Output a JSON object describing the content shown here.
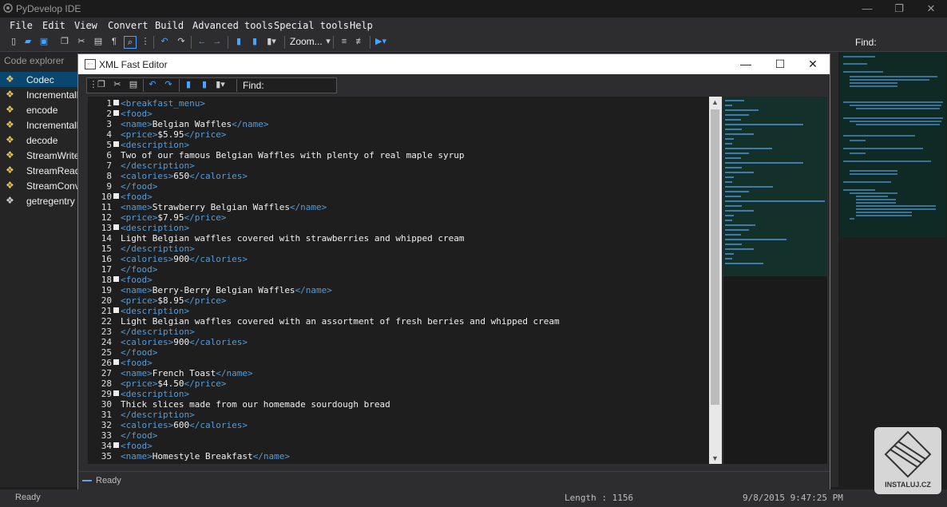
{
  "app": {
    "title": "PyDevelop IDE"
  },
  "menu": [
    "File",
    "Edit",
    "View",
    "Convert",
    "Build",
    "Advanced tools",
    "Special tools",
    "Help"
  ],
  "toolbar": {
    "zoom_label": "Zoom...",
    "find_label": "Find:"
  },
  "explorer": {
    "header": "Code explorer",
    "items": [
      "Codec",
      "Incrementall",
      "encode",
      "Incrementall",
      "decode",
      "StreamWrite",
      "StreamRead",
      "StreamConv",
      "getregentry"
    ]
  },
  "dialog": {
    "title": "XML Fast Editor",
    "find_label": "Find:",
    "status": "Ready"
  },
  "editor": {
    "lines": [
      {
        "n": "1",
        "fold": true,
        "parts": [
          [
            "tag",
            "<breakfast_menu>"
          ]
        ]
      },
      {
        "n": "2",
        "fold": true,
        "parts": [
          [
            "tag",
            "<food>"
          ]
        ]
      },
      {
        "n": "3",
        "fold": false,
        "parts": [
          [
            "tag",
            "<name>"
          ],
          [
            "txt",
            "Belgian Waffles"
          ],
          [
            "tag",
            "</name>"
          ]
        ]
      },
      {
        "n": "4",
        "fold": false,
        "parts": [
          [
            "tag",
            "<price>"
          ],
          [
            "txt",
            "$5.95"
          ],
          [
            "tag",
            "</price>"
          ]
        ]
      },
      {
        "n": "5",
        "fold": true,
        "parts": [
          [
            "tag",
            "<description>"
          ]
        ]
      },
      {
        "n": "6",
        "fold": false,
        "parts": [
          [
            "txt",
            "Two of our famous Belgian Waffles with plenty of real maple syrup"
          ]
        ]
      },
      {
        "n": "7",
        "fold": false,
        "parts": [
          [
            "tag",
            "</description>"
          ]
        ]
      },
      {
        "n": "8",
        "fold": false,
        "parts": [
          [
            "tag",
            "<calories>"
          ],
          [
            "txt",
            "650"
          ],
          [
            "tag",
            "</calories>"
          ]
        ]
      },
      {
        "n": "9",
        "fold": false,
        "parts": [
          [
            "tag",
            "</food>"
          ]
        ]
      },
      {
        "n": "10",
        "fold": true,
        "parts": [
          [
            "tag",
            "<food>"
          ]
        ]
      },
      {
        "n": "11",
        "fold": false,
        "parts": [
          [
            "tag",
            "<name>"
          ],
          [
            "txt",
            "Strawberry Belgian Waffles"
          ],
          [
            "tag",
            "</name>"
          ]
        ]
      },
      {
        "n": "12",
        "fold": false,
        "parts": [
          [
            "tag",
            "<price>"
          ],
          [
            "txt",
            "$7.95"
          ],
          [
            "tag",
            "</price>"
          ]
        ]
      },
      {
        "n": "13",
        "fold": true,
        "parts": [
          [
            "tag",
            "<description>"
          ]
        ]
      },
      {
        "n": "14",
        "fold": false,
        "parts": [
          [
            "txt",
            "Light Belgian waffles covered with strawberries and whipped cream"
          ]
        ]
      },
      {
        "n": "15",
        "fold": false,
        "parts": [
          [
            "tag",
            "</description>"
          ]
        ]
      },
      {
        "n": "16",
        "fold": false,
        "parts": [
          [
            "tag",
            "<calories>"
          ],
          [
            "txt",
            "900"
          ],
          [
            "tag",
            "</calories>"
          ]
        ]
      },
      {
        "n": "17",
        "fold": false,
        "parts": [
          [
            "tag",
            "</food>"
          ]
        ]
      },
      {
        "n": "18",
        "fold": true,
        "parts": [
          [
            "tag",
            "<food>"
          ]
        ]
      },
      {
        "n": "19",
        "fold": false,
        "parts": [
          [
            "tag",
            "<name>"
          ],
          [
            "txt",
            "Berry-Berry Belgian Waffles"
          ],
          [
            "tag",
            "</name>"
          ]
        ]
      },
      {
        "n": "20",
        "fold": false,
        "parts": [
          [
            "tag",
            "<price>"
          ],
          [
            "txt",
            "$8.95"
          ],
          [
            "tag",
            "</price>"
          ]
        ]
      },
      {
        "n": "21",
        "fold": true,
        "parts": [
          [
            "tag",
            "<description>"
          ]
        ]
      },
      {
        "n": "22",
        "fold": false,
        "parts": [
          [
            "txt",
            "Light Belgian waffles covered with an assortment of fresh berries and whipped cream"
          ]
        ]
      },
      {
        "n": "23",
        "fold": false,
        "parts": [
          [
            "tag",
            "</description>"
          ]
        ]
      },
      {
        "n": "24",
        "fold": false,
        "parts": [
          [
            "tag",
            "<calories>"
          ],
          [
            "txt",
            "900"
          ],
          [
            "tag",
            "</calories>"
          ]
        ]
      },
      {
        "n": "25",
        "fold": false,
        "parts": [
          [
            "tag",
            "</food>"
          ]
        ]
      },
      {
        "n": "26",
        "fold": true,
        "parts": [
          [
            "tag",
            "<food>"
          ]
        ]
      },
      {
        "n": "27",
        "fold": false,
        "parts": [
          [
            "tag",
            "<name>"
          ],
          [
            "txt",
            "French Toast"
          ],
          [
            "tag",
            "</name>"
          ]
        ]
      },
      {
        "n": "28",
        "fold": false,
        "parts": [
          [
            "tag",
            "<price>"
          ],
          [
            "txt",
            "$4.50"
          ],
          [
            "tag",
            "</price>"
          ]
        ]
      },
      {
        "n": "29",
        "fold": true,
        "parts": [
          [
            "tag",
            "<description>"
          ]
        ]
      },
      {
        "n": "30",
        "fold": false,
        "parts": [
          [
            "txt",
            "Thick slices made from our homemade sourdough bread"
          ]
        ]
      },
      {
        "n": "31",
        "fold": false,
        "parts": [
          [
            "tag",
            "</description>"
          ]
        ]
      },
      {
        "n": "32",
        "fold": false,
        "parts": [
          [
            "tag",
            "<calories>"
          ],
          [
            "txt",
            "600"
          ],
          [
            "tag",
            "</calories>"
          ]
        ]
      },
      {
        "n": "33",
        "fold": false,
        "parts": [
          [
            "tag",
            "</food>"
          ]
        ]
      },
      {
        "n": "34",
        "fold": true,
        "parts": [
          [
            "tag",
            "<food>"
          ]
        ]
      },
      {
        "n": "35",
        "fold": false,
        "parts": [
          [
            "tag",
            "<name>"
          ],
          [
            "txt",
            "Homestyle Breakfast"
          ],
          [
            "tag",
            "</name>"
          ]
        ]
      }
    ]
  },
  "status": {
    "ready": "Ready",
    "length": "Length : 1156",
    "datetime": "9/8/2015 9:47:25 PM"
  },
  "watermark": {
    "text": "INSTALUJ.CZ"
  },
  "colors": {
    "tag": "#569cd6",
    "text": "#f0f0f0",
    "background": "#1e1e1e",
    "selection": "#094771"
  }
}
